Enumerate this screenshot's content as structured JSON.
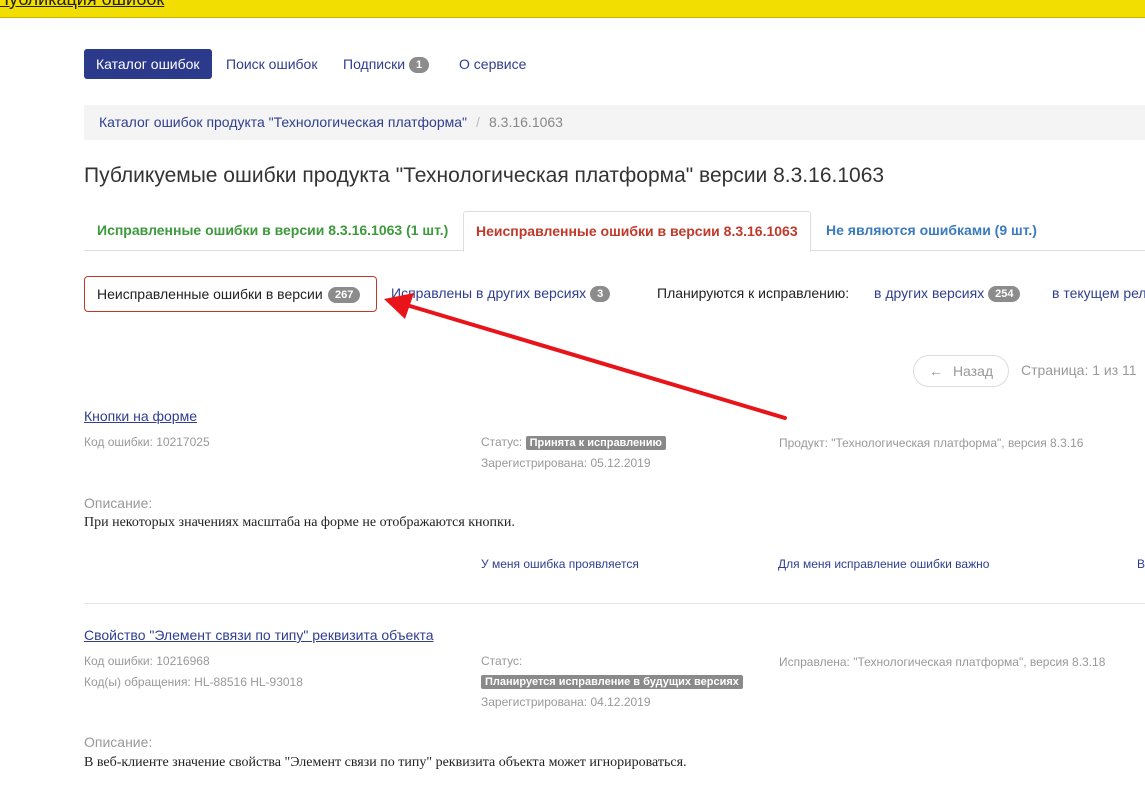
{
  "header": {
    "title": "Публикация ошибок"
  },
  "nav": {
    "items": [
      {
        "label": "Каталог ошибок"
      },
      {
        "label": "Поиск ошибок"
      },
      {
        "label": "Подписки",
        "badge": "1"
      },
      {
        "label": "О сервисе"
      }
    ]
  },
  "breadcrumb": {
    "parent": "Каталог ошибок продукта \"Технологическая платформа\"",
    "separator": "/",
    "current": "8.3.16.1063"
  },
  "page_title": "Публикуемые ошибки продукта \"Технологическая платформа\" версии 8.3.16.1063",
  "tabs": [
    {
      "label": "Исправленные ошибки в версии 8.3.16.1063 (1 шт.)",
      "color": "#3c9a3c"
    },
    {
      "label": "Неисправленные ошибки в версии 8.3.16.1063",
      "color": "#c0392b"
    },
    {
      "label": "Не являются ошибками (9 шт.)",
      "color": "#3a7bbf"
    }
  ],
  "subnav": {
    "active": {
      "label": "Неисправленные ошибки в версии",
      "badge": "267"
    },
    "other_versions": {
      "label": "Исправлены в других версиях",
      "badge": "3"
    },
    "planned_label": "Планируются к исправлению:",
    "planned_other": {
      "label": "в других версиях",
      "badge": "254"
    },
    "planned_current": {
      "label": "в текущем рел"
    }
  },
  "pager": {
    "back_arrow": "←",
    "back": "Назад",
    "info": "Страница: 1 из 11"
  },
  "errors": [
    {
      "title": "Кнопки на форме",
      "code": "Код ошибки: 10217025",
      "status_label": "Статус:",
      "status": "Принята к исправлению",
      "registered": "Зарегистрирована: 05.12.2019",
      "product": "Продукт: \"Технологическая платформа\", версия 8.3.16",
      "desc_label": "Описание:",
      "desc": "При некоторых значениях масштаба на форме не отображаются кнопки.",
      "action_1": "У меня ошибка проявляется",
      "action_2": "Для меня исправление ошибки важно",
      "action_3": "В"
    },
    {
      "title": "Свойство \"Элемент связи по типу\" реквизита объекта",
      "code": "Код ошибки: 10216968",
      "requests": "Код(ы) обращения: HL-88516 HL-93018",
      "status_label": "Статус:",
      "status": "Планируется исправление в будущих версиях",
      "registered": "Зарегистрирована: 04.12.2019",
      "product": "Исправлена: \"Технологическая платформа\", версия 8.3.18",
      "desc_label": "Описание:",
      "desc": "В веб-клиенте значение свойства \"Элемент связи по типу\" реквизита объекта может игнорироваться."
    }
  ],
  "colors": {
    "accent": "#2c3a8c",
    "arrow": "#e8141a",
    "topbar": "#f2de00"
  }
}
